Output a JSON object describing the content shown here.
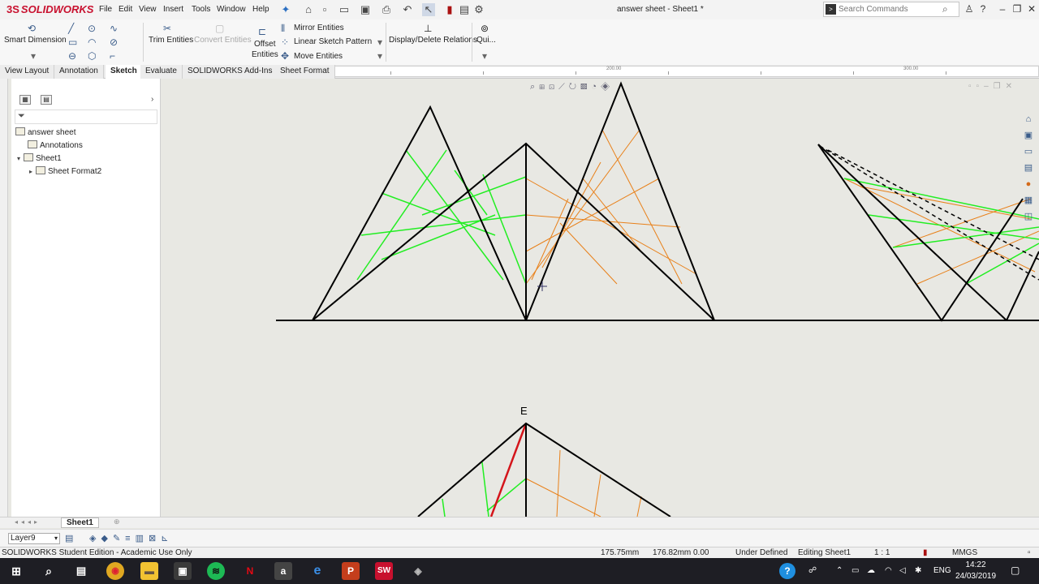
{
  "app": {
    "brand": "SOLIDWORKS",
    "doc_title": "answer sheet - Sheet1 *",
    "menu": [
      "File",
      "Edit",
      "View",
      "Insert",
      "Tools",
      "Window",
      "Help"
    ],
    "search_placeholder": "Search Commands"
  },
  "ribbon": {
    "smart_dimension": "Smart Dimension",
    "trim_entities": "Trim Entities",
    "convert_entities": "Convert Entities",
    "offset_entities_1": "Offset",
    "offset_entities_2": "Entities",
    "mirror_entities": "Mirror Entities",
    "linear_sketch_pattern": "Linear Sketch Pattern",
    "move_entities": "Move Entities",
    "display_delete_relations": "Display/Delete Relations",
    "quick_snaps": "Qui..."
  },
  "tabs": [
    {
      "label": "View Layout",
      "active": false
    },
    {
      "label": "Annotation",
      "active": false
    },
    {
      "label": "Sketch",
      "active": true
    },
    {
      "label": "Evaluate",
      "active": false
    },
    {
      "label": "SOLIDWORKS Add-Ins",
      "active": false
    },
    {
      "label": "Sheet Format",
      "active": false
    }
  ],
  "ruler": {
    "label_1": "200.00",
    "label_2": "300.00"
  },
  "tree": {
    "root": "answer sheet",
    "annotations": "Annotations",
    "sheet": "Sheet1",
    "sheet_format": "Sheet Format2"
  },
  "drawing": {
    "label_e": "E"
  },
  "sheet_tab": "Sheet1",
  "layer": "Layer9",
  "status": {
    "edition": "SOLIDWORKS Student Edition - Academic Use Only",
    "x_coord": "175.75mm",
    "y_coord": "176.82mm",
    "z_coord": "0.00",
    "state": "Under Defined",
    "editing": "Editing Sheet1",
    "scale": "1 : 1",
    "units": "MMGS"
  },
  "taskbar": {
    "lang": "ENG",
    "time": "14:22",
    "date": "24/03/2019"
  },
  "colors": {
    "accent_red": "#c8102e",
    "green_line": "#22ee22",
    "orange_line": "#e88019",
    "red_line": "#d4151b"
  }
}
